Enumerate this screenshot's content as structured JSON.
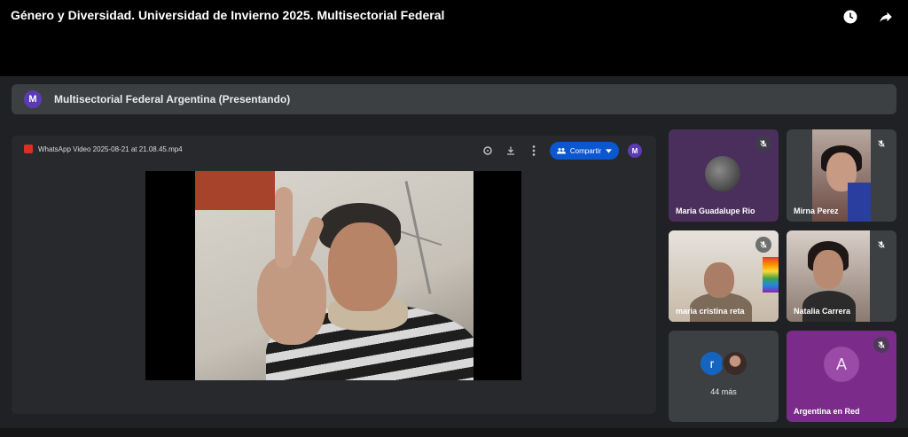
{
  "video_title": "Género y Diversidad. Universidad de Invierno 2025. Multisectorial Federal",
  "yt_icons": [
    "watch-later-icon",
    "share-icon"
  ],
  "presenting": {
    "avatar_letter": "M",
    "text": "Multisectorial Federal Argentina (Presentando)"
  },
  "presentation": {
    "file_name": "WhatsApp Video 2025-08-21 at 21.08.45.mp4",
    "share_label": "Compartir",
    "avatar_letter": "M"
  },
  "participants": [
    {
      "name": "Maria Guadalupe Rio",
      "muted": true
    },
    {
      "name": "Mirna Perez",
      "muted": true
    },
    {
      "name": "maria cristina reta",
      "muted": true
    },
    {
      "name": "Natalia Carrera",
      "muted": true
    }
  ],
  "more_tile": {
    "avatar_letter": "r",
    "label": "44 más"
  },
  "last_tile": {
    "name": "Argentina en Red",
    "avatar_letter": "A",
    "muted": true
  },
  "colors": {
    "meet_bg": "#202124",
    "accent_blue": "#0b57d0",
    "presenter_purple": "#5b3bb5",
    "tile_purple": "#7b2c8b"
  }
}
